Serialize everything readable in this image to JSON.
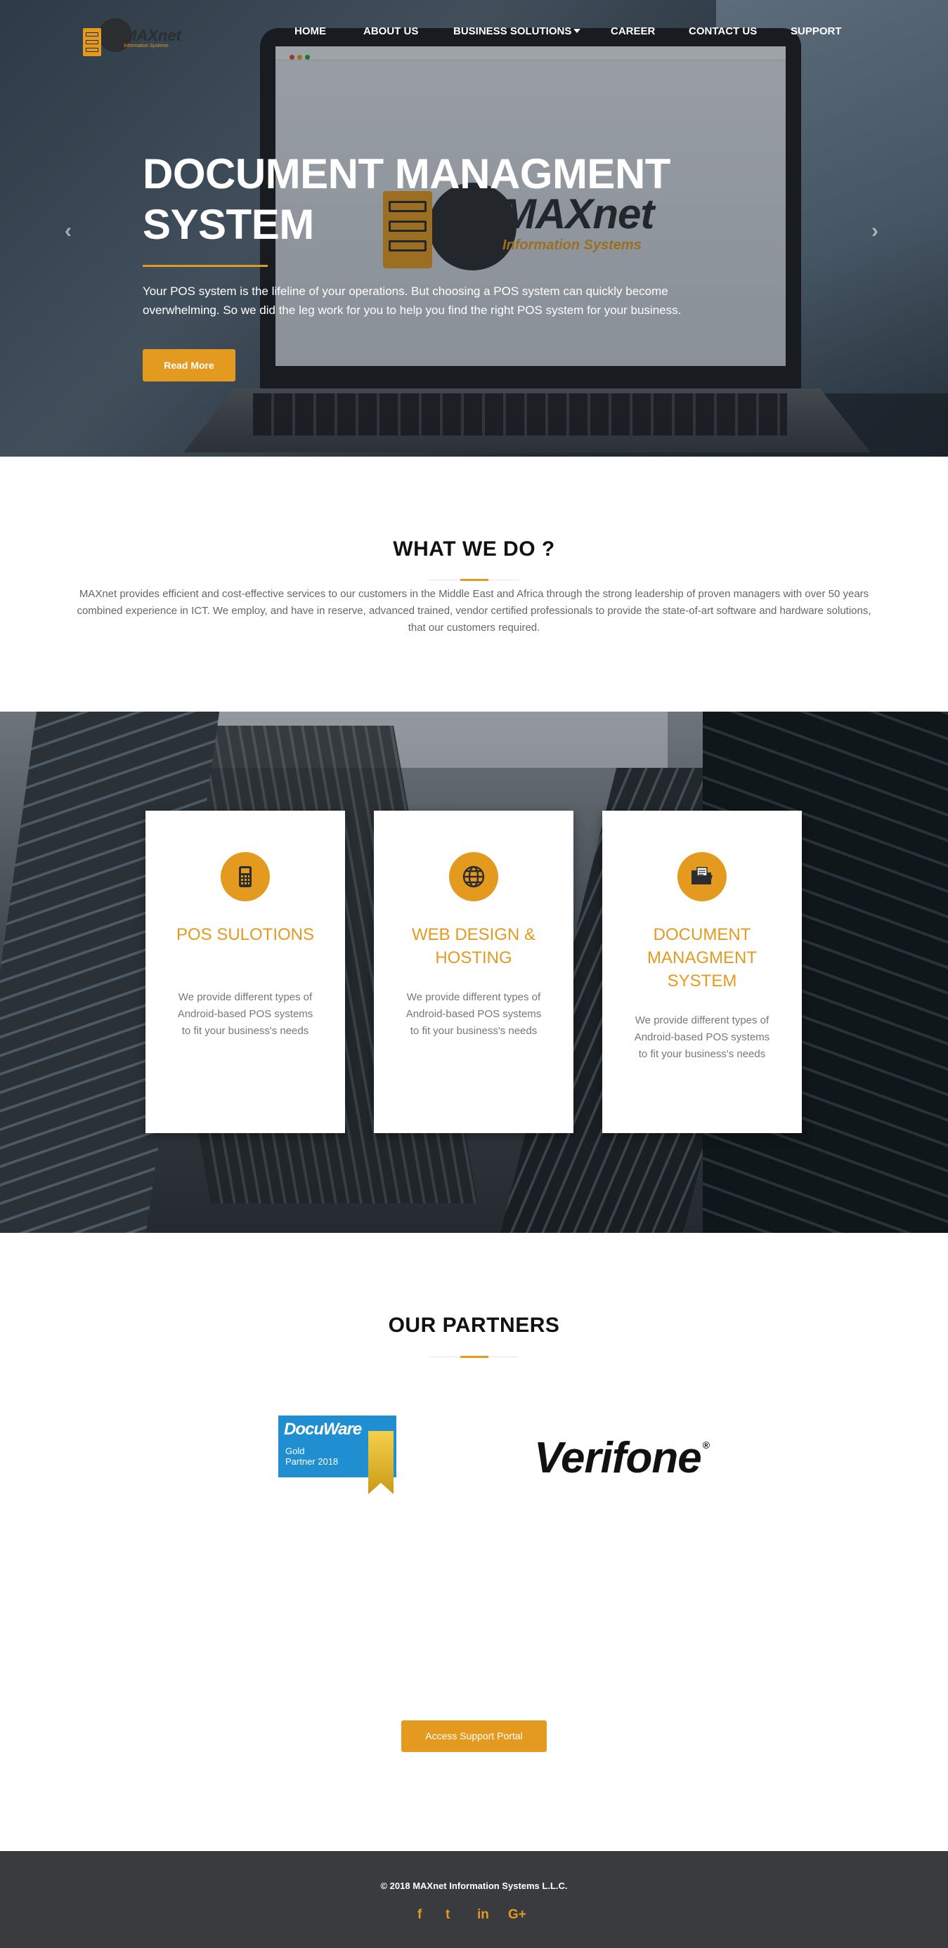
{
  "brand": {
    "name": "MAXnet",
    "tagline": "Information Systems",
    "accent_color": "#e39a1f",
    "dark_color": "#2b2d30"
  },
  "nav": {
    "items": [
      {
        "label": "HOME"
      },
      {
        "label": "ABOUT US"
      },
      {
        "label": "BUSINESS SOLUTIONS",
        "has_dropdown": true
      },
      {
        "label": "CAREER"
      },
      {
        "label": "CONTACT US"
      },
      {
        "label": "SUPPORT"
      }
    ]
  },
  "hero": {
    "title": "DOCUMENT MANAGMENT SYSTEM",
    "text": "Your POS system is the lifeline of your operations. But choosing a POS system can quickly become overwhelming. So we did the leg work for you to help you find the right POS system for your business.",
    "button_label": "Read More",
    "prev_icon": "chevron-left-icon",
    "next_icon": "chevron-right-icon"
  },
  "what_we_do": {
    "title": "WHAT WE DO ?",
    "text": "MAXnet provides efficient and cost-effective services to our customers in the Middle East and Africa through the strong leadership of proven managers with over 50 years combined experience in ICT. We employ, and have in reserve, advanced trained, vendor certified professionals to provide the state-of-art software and hardware solutions, that our customers required."
  },
  "services": [
    {
      "title": "POS SULOTIONS",
      "icon": "pos-terminal-icon",
      "description": "We provide different types of Android-based POS systems to fit your business's needs"
    },
    {
      "title": "WEB DESIGN & HOSTING",
      "icon": "globe-icon",
      "description": "We provide different types of Android-based POS systems to fit your business's needs"
    },
    {
      "title": "DOCUMENT MANAGMENT SYSTEM",
      "icon": "folder-icon",
      "description": "We provide different types of Android-based POS systems to fit your business's needs"
    }
  ],
  "partners": {
    "title": "OUR PARTNERS",
    "docuware": {
      "brand": "DocuWare",
      "line1": "Gold",
      "line2": "Partner 2018",
      "color": "#1f8fd1"
    },
    "verifone": {
      "brand": "Verifone",
      "mark": "®"
    }
  },
  "support": {
    "button_label": "Access Support Portal"
  },
  "footer": {
    "copyright": "© 2018 MAXnet Information Systems L.L.C.",
    "background_color": "#3a3b3f",
    "social": [
      {
        "icon": "facebook-icon",
        "glyph": "f"
      },
      {
        "icon": "twitter-icon",
        "glyph": "t"
      },
      {
        "icon": "linkedin-icon",
        "glyph": "in"
      },
      {
        "icon": "google-plus-icon",
        "glyph": "G+"
      }
    ]
  }
}
